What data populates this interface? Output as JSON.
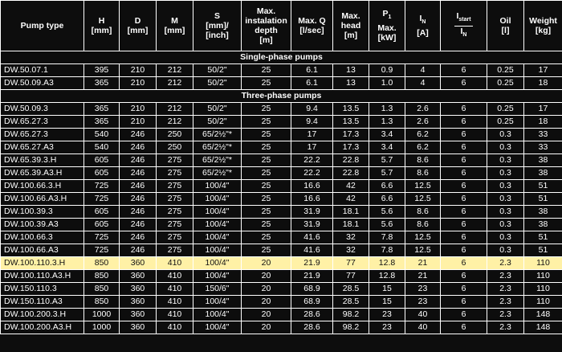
{
  "headers": {
    "pump_type": "Pump type",
    "h": "H",
    "h_unit": "[mm]",
    "d": "D",
    "d_unit": "[mm]",
    "m": "M",
    "m_unit": "[mm]",
    "s": "S",
    "s_unit": "[mm]/ [inch]",
    "depth": "Max. instalation depth",
    "depth_unit": "[m]",
    "q": "Max. Q",
    "q_unit": "[l/sec]",
    "head": "Max. head",
    "head_unit": "[m]",
    "p1_p": "P",
    "p1_sub": "1",
    "p1_max": "Max.",
    "p1_unit": "[kW]",
    "in": "I",
    "in_sub": "N",
    "in_unit": "[A]",
    "istart_i": "I",
    "istart_sub": "start",
    "istart_den_i": "I",
    "istart_den_sub": "N",
    "oil": "Oil",
    "oil_unit": "[l]",
    "weight": "Weight",
    "weight_unit": "[kg]"
  },
  "sections": {
    "single": "Single-phase pumps",
    "three": "Three-phase pumps"
  },
  "single_phase": [
    [
      "DW.50.07.1",
      "395",
      "210",
      "212",
      "50/2\"",
      "25",
      "6.1",
      "13",
      "0.9",
      "4",
      "6",
      "0.25",
      "17"
    ],
    [
      "DW.50.09.A3",
      "365",
      "210",
      "212",
      "50/2\"",
      "25",
      "6.1",
      "13",
      "1.0",
      "4",
      "6",
      "0.25",
      "18"
    ]
  ],
  "three_phase": [
    [
      "DW.50.09.3",
      "365",
      "210",
      "212",
      "50/2\"",
      "25",
      "9.4",
      "13.5",
      "1.3",
      "2.6",
      "6",
      "0.25",
      "17"
    ],
    [
      "DW.65.27.3",
      "365",
      "210",
      "212",
      "50/2\"",
      "25",
      "9.4",
      "13.5",
      "1.3",
      "2.6",
      "6",
      "0.25",
      "18"
    ],
    [
      "DW.65.27.3",
      "540",
      "246",
      "250",
      "65/2½\"*",
      "25",
      "17",
      "17.3",
      "3.4",
      "6.2",
      "6",
      "0.3",
      "33"
    ],
    [
      "DW.65.27.A3",
      "540",
      "246",
      "250",
      "65/2½\"*",
      "25",
      "17",
      "17.3",
      "3.4",
      "6.2",
      "6",
      "0.3",
      "33"
    ],
    [
      "DW.65.39.3.H",
      "605",
      "246",
      "275",
      "65/2½\"*",
      "25",
      "22.2",
      "22.8",
      "5.7",
      "8.6",
      "6",
      "0.3",
      "38"
    ],
    [
      "DW.65.39.A3.H",
      "605",
      "246",
      "275",
      "65/2½\"*",
      "25",
      "22.2",
      "22.8",
      "5.7",
      "8.6",
      "6",
      "0.3",
      "38"
    ],
    [
      "DW.100.66.3.H",
      "725",
      "246",
      "275",
      "100/4\"",
      "25",
      "16.6",
      "42",
      "6.6",
      "12.5",
      "6",
      "0.3",
      "51"
    ],
    [
      "DW.100.66.A3.H",
      "725",
      "246",
      "275",
      "100/4\"",
      "25",
      "16.6",
      "42",
      "6.6",
      "12.5",
      "6",
      "0.3",
      "51"
    ],
    [
      "DW.100.39.3",
      "605",
      "246",
      "275",
      "100/4\"",
      "25",
      "31.9",
      "18.1",
      "5.6",
      "8.6",
      "6",
      "0.3",
      "38"
    ],
    [
      "DW.100.39.A3",
      "605",
      "246",
      "275",
      "100/4\"",
      "25",
      "31.9",
      "18.1",
      "5.6",
      "8.6",
      "6",
      "0.3",
      "38"
    ],
    [
      "DW.100.66.3",
      "725",
      "246",
      "275",
      "100/4\"",
      "25",
      "41.6",
      "32",
      "7.8",
      "12.5",
      "6",
      "0.3",
      "51"
    ],
    [
      "DW.100.66.A3",
      "725",
      "246",
      "275",
      "100/4\"",
      "25",
      "41.6",
      "32",
      "7.8",
      "12.5",
      "6",
      "0.3",
      "51"
    ],
    [
      "DW.100.110.3.H",
      "850",
      "360",
      "410",
      "100/4\"",
      "20",
      "21.9",
      "77",
      "12.8",
      "21",
      "6",
      "2.3",
      "110"
    ],
    [
      "DW.100.110.A3.H",
      "850",
      "360",
      "410",
      "100/4\"",
      "20",
      "21.9",
      "77",
      "12.8",
      "21",
      "6",
      "2.3",
      "110"
    ],
    [
      "DW.150.110.3",
      "850",
      "360",
      "410",
      "150/6\"",
      "20",
      "68.9",
      "28.5",
      "15",
      "23",
      "6",
      "2.3",
      "110"
    ],
    [
      "DW.150.110.A3",
      "850",
      "360",
      "410",
      "100/4\"",
      "20",
      "68.9",
      "28.5",
      "15",
      "23",
      "6",
      "2.3",
      "110"
    ],
    [
      "DW.100.200.3.H",
      "1000",
      "360",
      "410",
      "100/4\"",
      "20",
      "28.6",
      "98.2",
      "23",
      "40",
      "6",
      "2.3",
      "148"
    ],
    [
      "DW.100.200.A3.H",
      "1000",
      "360",
      "410",
      "100/4\"",
      "20",
      "28.6",
      "98.2",
      "23",
      "40",
      "6",
      "2.3",
      "148"
    ]
  ],
  "highlight_index": 12,
  "colors": {
    "background": "#0d0d0d",
    "text": "#ffffff",
    "highlight": "#fff1a6",
    "highlight_text": "#111111"
  }
}
